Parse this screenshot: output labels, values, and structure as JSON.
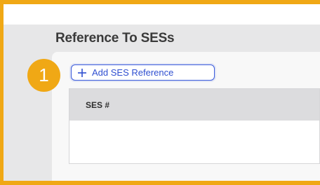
{
  "section": {
    "title": "Reference To SESs",
    "add_button_label": "Add SES Reference"
  },
  "step_badge": "1",
  "table": {
    "columns": [
      "SES #"
    ],
    "rows": []
  },
  "colors": {
    "highlight": "#f0a815",
    "button_accent": "#3b5bdb"
  },
  "icons": {
    "add_button": "plus-icon"
  }
}
